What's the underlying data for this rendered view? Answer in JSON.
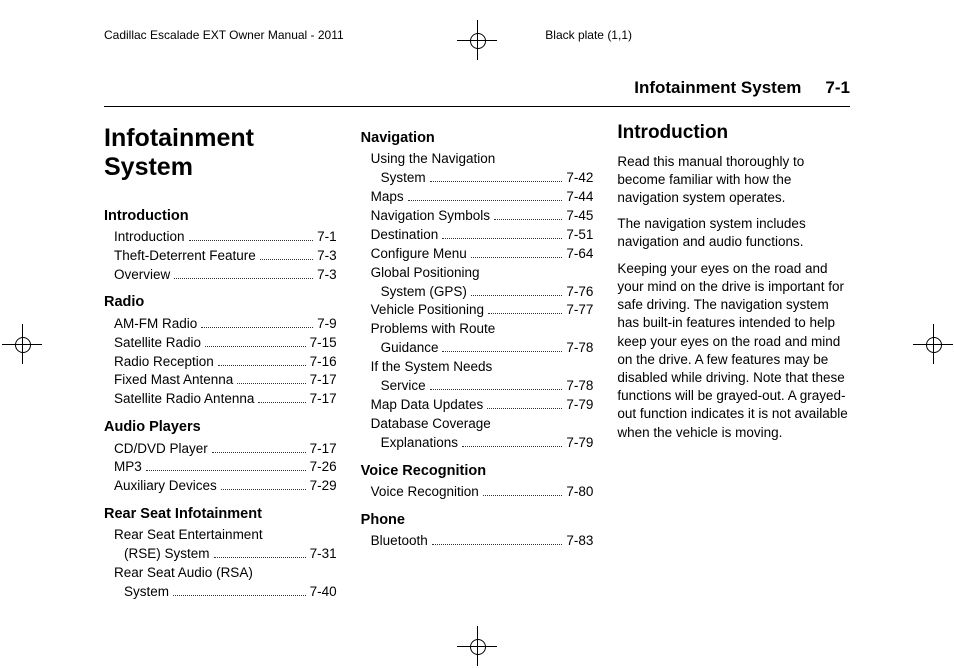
{
  "meta": {
    "docTitle": "Cadillac Escalade EXT Owner Manual - 2011",
    "plate": "Black plate (1,1)",
    "sectionTitle": "Infotainment System",
    "pageNum": "7-1"
  },
  "chapterTitle": "Infotainment System",
  "toc": [
    {
      "head": "Introduction",
      "items": [
        {
          "label": "Introduction",
          "page": "7-1"
        },
        {
          "label": "Theft-Deterrent Feature",
          "page": "7-3"
        },
        {
          "label": "Overview",
          "page": "7-3"
        }
      ]
    },
    {
      "head": "Radio",
      "items": [
        {
          "label": "AM-FM Radio",
          "page": "7-9"
        },
        {
          "label": "Satellite Radio",
          "page": "7-15"
        },
        {
          "label": "Radio Reception",
          "page": "7-16"
        },
        {
          "label": "Fixed Mast Antenna",
          "page": "7-17"
        },
        {
          "label": "Satellite Radio Antenna",
          "page": "7-17"
        }
      ]
    },
    {
      "head": "Audio Players",
      "items": [
        {
          "label": "CD/DVD Player",
          "page": "7-17"
        },
        {
          "label": "MP3",
          "page": "7-26"
        },
        {
          "label": "Auxiliary Devices",
          "page": "7-29"
        }
      ]
    },
    {
      "head": "Rear Seat Infotainment",
      "items": [
        {
          "label": "Rear Seat Entertainment (RSE) System",
          "page": "7-31",
          "wrap": [
            "Rear Seat Entertainment",
            "(RSE) System"
          ]
        },
        {
          "label": "Rear Seat Audio (RSA) System",
          "page": "7-40",
          "wrap": [
            "Rear Seat Audio (RSA)",
            "System"
          ]
        }
      ]
    },
    {
      "head": "Navigation",
      "items": [
        {
          "label": "Using the Navigation System",
          "page": "7-42",
          "wrap": [
            "Using the Navigation",
            "System"
          ]
        },
        {
          "label": "Maps",
          "page": "7-44"
        },
        {
          "label": "Navigation Symbols",
          "page": "7-45"
        },
        {
          "label": "Destination",
          "page": "7-51"
        },
        {
          "label": "Configure Menu",
          "page": "7-64"
        },
        {
          "label": "Global Positioning System (GPS)",
          "page": "7-76",
          "wrap": [
            "Global Positioning",
            "System (GPS)"
          ]
        },
        {
          "label": "Vehicle Positioning",
          "page": "7-77"
        },
        {
          "label": "Problems with Route Guidance",
          "page": "7-78",
          "wrap": [
            "Problems with Route",
            "Guidance"
          ]
        },
        {
          "label": "If the System Needs Service",
          "page": "7-78",
          "wrap": [
            "If the System Needs",
            "Service"
          ]
        },
        {
          "label": "Map Data Updates",
          "page": "7-79"
        },
        {
          "label": "Database Coverage Explanations",
          "page": "7-79",
          "wrap": [
            "Database Coverage",
            "Explanations"
          ]
        }
      ]
    },
    {
      "head": "Voice Recognition",
      "items": [
        {
          "label": "Voice Recognition",
          "page": "7-80"
        }
      ]
    },
    {
      "head": "Phone",
      "items": [
        {
          "label": "Bluetooth",
          "page": "7-83"
        }
      ]
    }
  ],
  "intro": {
    "heading": "Introduction",
    "paragraphs": [
      "Read this manual thoroughly to become familiar with how the navigation system operates.",
      "The navigation system includes navigation and audio functions.",
      "Keeping your eyes on the road and your mind on the drive is important for safe driving. The navigation system has built-in features intended to help keep your eyes on the road and mind on the drive. A few features may be disabled while driving. Note that these functions will be grayed-out. A grayed-out function indicates it is not available when the vehicle is moving."
    ]
  },
  "splitAfterSection": 3
}
